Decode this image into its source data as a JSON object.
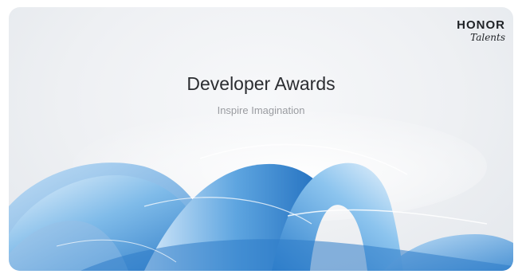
{
  "brand": {
    "name": "HONOR",
    "sub": "Talents"
  },
  "hero": {
    "title": "Developer Awards",
    "subtitle": "Inspire Imagination"
  },
  "colors": {
    "ribbon_light": "#cfe6f8",
    "ribbon_mid": "#6fb1e6",
    "ribbon_dark": "#1f6fbf",
    "background": "#eef0f3"
  }
}
